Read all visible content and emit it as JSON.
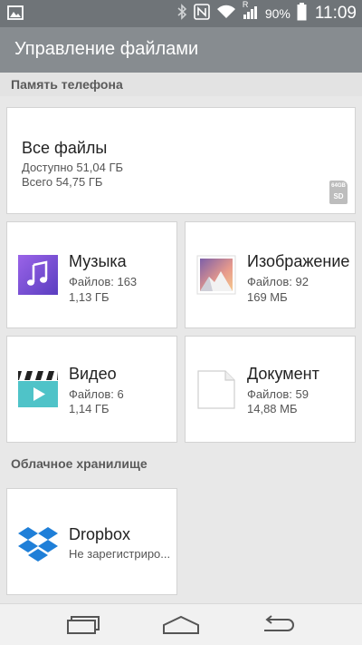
{
  "status_bar": {
    "battery_percent": "90%",
    "time": "11:09",
    "icons": [
      "image-notification-icon",
      "bluetooth-icon",
      "nfc-icon",
      "wifi-icon",
      "signal-icon",
      "battery-icon"
    ],
    "roaming_marker": "R"
  },
  "app_bar": {
    "title": "Управление файлами"
  },
  "phone_storage": {
    "header": "Память телефона",
    "all_files": {
      "title": "Все файлы",
      "available": "Доступно 51,04 ГБ",
      "total": "Всего 54,75 ГБ",
      "sd_label_top": "64GB",
      "sd_label": "SD"
    },
    "categories": [
      {
        "title": "Музыка",
        "files": "Файлов: 163",
        "size": "1,13 ГБ",
        "icon": "music-icon"
      },
      {
        "title": "Изображение",
        "files": "Файлов: 92",
        "size": "169 МБ",
        "icon": "image-icon"
      },
      {
        "title": "Видео",
        "files": "Файлов: 6",
        "size": "1,14 ГБ",
        "icon": "video-icon"
      },
      {
        "title": "Документ",
        "files": "Файлов: 59",
        "size": "14,88 МБ",
        "icon": "document-icon"
      }
    ]
  },
  "cloud_storage": {
    "header": "Облачное хранилище",
    "services": [
      {
        "title": "Dropbox",
        "status": "Не зарегистриро...",
        "icon": "dropbox-icon"
      }
    ]
  },
  "nav_bar": {
    "icons": [
      "recent-apps-icon",
      "home-icon",
      "back-icon"
    ]
  },
  "colors": {
    "status_bar": "#6f7478",
    "app_bar": "#878c90",
    "music": "#7b4fd0",
    "video": "#4fc3c8",
    "dropbox": "#1f7fd8"
  }
}
